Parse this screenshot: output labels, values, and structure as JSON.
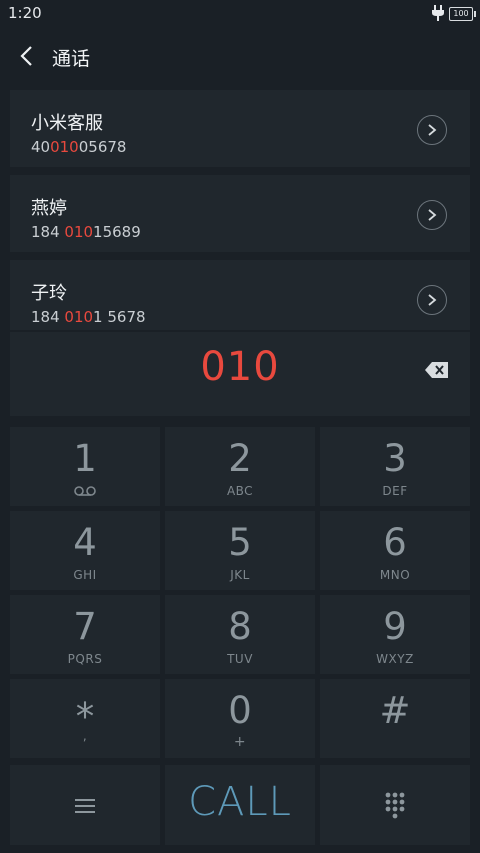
{
  "status_bar": {
    "time": "1:20",
    "battery": "100"
  },
  "header": {
    "title": "通话"
  },
  "contacts": [
    {
      "name": "小米客服",
      "number_pre": "40",
      "number_match": "010",
      "number_post": "05678"
    },
    {
      "name": "燕婷",
      "number_pre": "184 ",
      "number_match": "010",
      "number_post": "15689"
    },
    {
      "name": "子玲",
      "number_pre": "184 ",
      "number_match": "010",
      "number_post": "1 5678"
    }
  ],
  "dialer": {
    "input": "010"
  },
  "keypad": [
    {
      "digit": "1",
      "letters": ""
    },
    {
      "digit": "2",
      "letters": "ABC"
    },
    {
      "digit": "3",
      "letters": "DEF"
    },
    {
      "digit": "4",
      "letters": "GHI"
    },
    {
      "digit": "5",
      "letters": "JKL"
    },
    {
      "digit": "6",
      "letters": "MNO"
    },
    {
      "digit": "7",
      "letters": "PQRS"
    },
    {
      "digit": "8",
      "letters": "TUV"
    },
    {
      "digit": "9",
      "letters": "WXYZ"
    },
    {
      "digit": "*",
      "letters": ","
    },
    {
      "digit": "0",
      "letters": "+"
    },
    {
      "digit": "#",
      "letters": ""
    }
  ],
  "actions": {
    "call_label": "CALL"
  },
  "colors": {
    "background": "#1a2026",
    "panel": "#20272d",
    "highlight": "#e8493e",
    "call": "#5e9ab9"
  },
  "icons": [
    "back-icon",
    "chevron-right-icon",
    "backspace-icon",
    "voicemail-icon",
    "menu-icon",
    "dialpad-icon",
    "plug-icon",
    "battery-icon"
  ]
}
